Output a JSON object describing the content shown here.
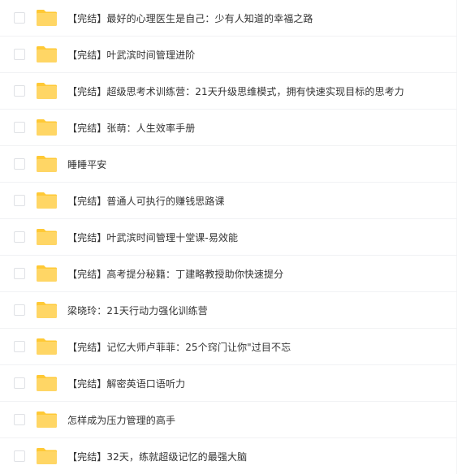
{
  "file_list": {
    "items": [
      {
        "name": "【完结】最好的心理医生是自己：少有人知道的幸福之路"
      },
      {
        "name": "【完结】叶武滨时间管理进阶"
      },
      {
        "name": "【完结】超级思考术训练营：21天升级思维模式，拥有快速实现目标的思考力"
      },
      {
        "name": "【完结】张萌：人生效率手册"
      },
      {
        "name": "睡睡平安"
      },
      {
        "name": "【完结】普通人可执行的赚钱思路课"
      },
      {
        "name": "【完结】叶武滨时间管理十堂课-易效能"
      },
      {
        "name": "【完结】高考提分秘籍：丁建略教授助你快速提分"
      },
      {
        "name": "梁晓玲：21天行动力强化训练营"
      },
      {
        "name": "【完结】记忆大师卢菲菲：25个窍门让你\"过目不忘"
      },
      {
        "name": "【完结】解密英语口语听力"
      },
      {
        "name": "怎样成为压力管理的高手"
      },
      {
        "name": "【完结】32天，练就超级记忆的最强大脑"
      }
    ]
  },
  "icons": {
    "folder": "folder-icon",
    "folder_color": "#FFD665",
    "folder_tab_color": "#FFC935"
  }
}
